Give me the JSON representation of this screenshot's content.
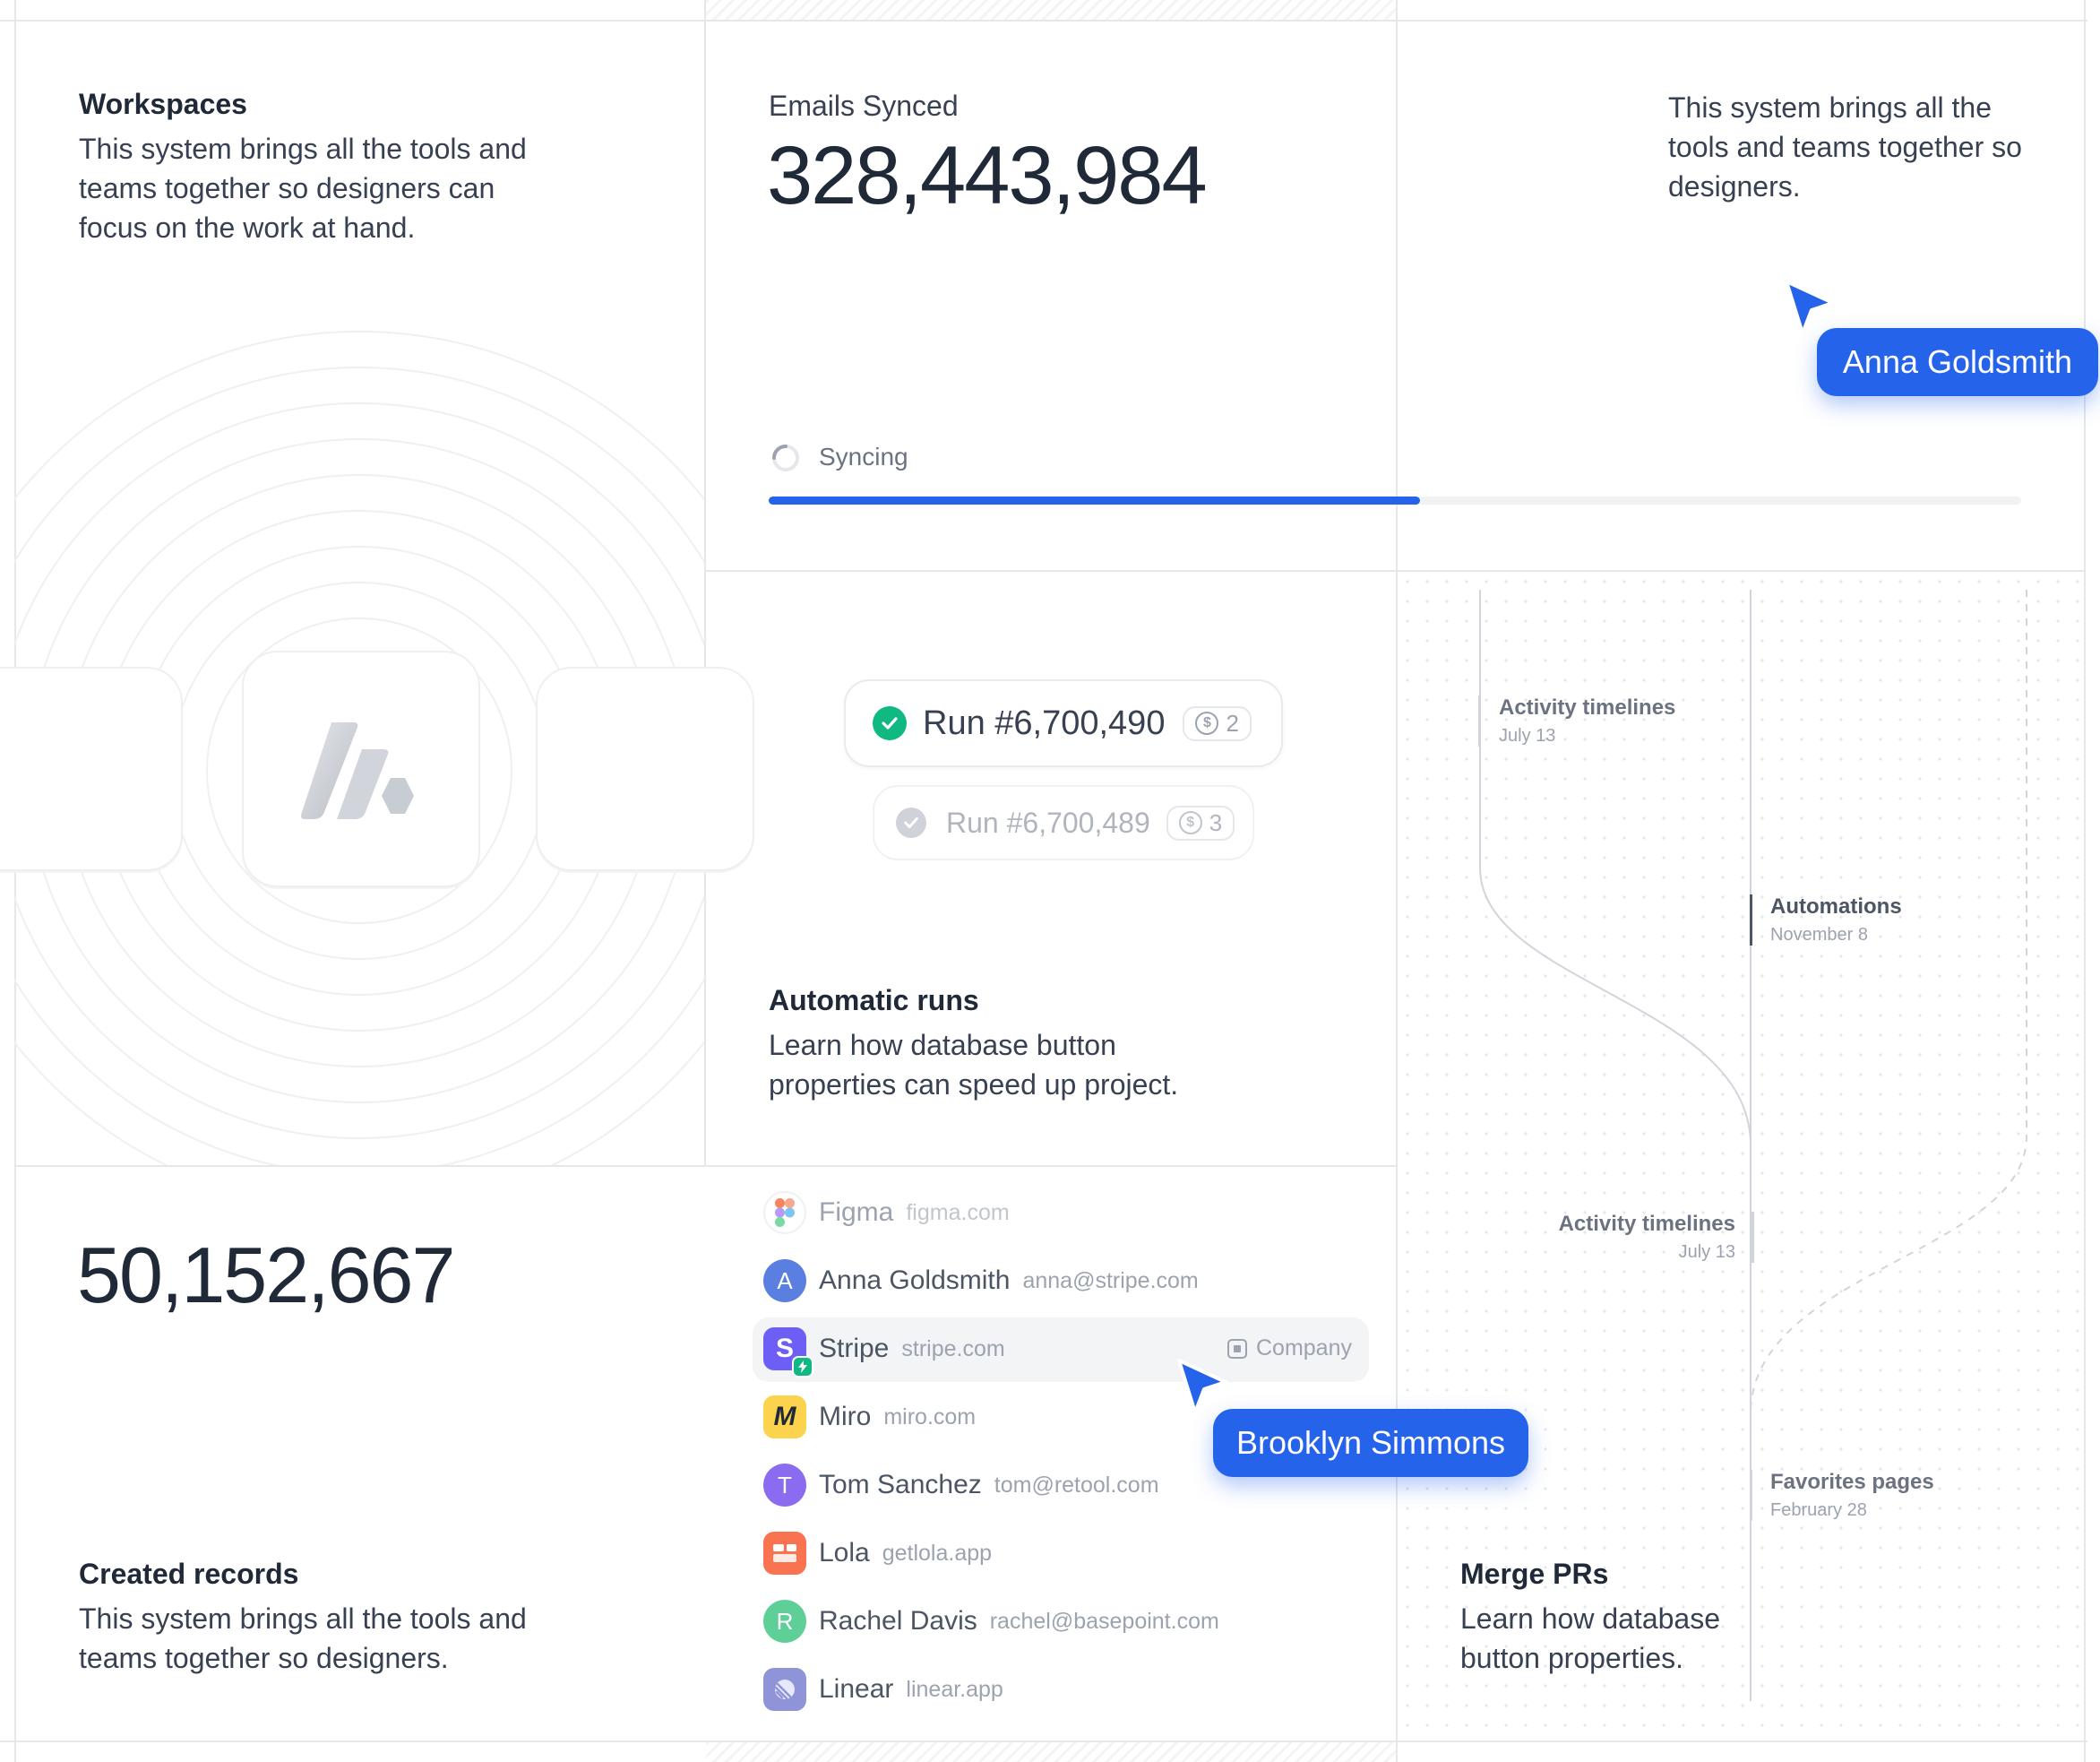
{
  "workspaces": {
    "title": "Workspaces",
    "description": "This system brings all the tools and teams together so designers can focus on the work at hand."
  },
  "emails": {
    "label": "Emails Synced",
    "count": "328,443,984",
    "side_text": "This system brings all the tools and teams together so designers.",
    "status": "Syncing",
    "progress": 0.52
  },
  "cursors": {
    "anna": "Anna Goldsmith",
    "brooklyn": "Brooklyn Simmons"
  },
  "runs": {
    "items": [
      {
        "label": "Run #6,700,490",
        "count": "2"
      },
      {
        "label": "Run #6,700,489",
        "count": "3"
      }
    ],
    "title": "Automatic runs",
    "description": "Learn how database button properties can speed up project."
  },
  "timeline": {
    "events": [
      {
        "title": "Activity timelines",
        "date": "July 13"
      },
      {
        "title": "Automations",
        "date": "November 8"
      },
      {
        "title": "Activity timelines",
        "date": "July 13"
      },
      {
        "title": "Favorites pages",
        "date": "February 28"
      }
    ]
  },
  "merge": {
    "title": "Merge PRs",
    "description": "Learn how database button properties."
  },
  "records": {
    "count": "50,152,667",
    "title": "Created records",
    "description": "This system brings all the tools and teams together so designers."
  },
  "contacts": [
    {
      "name": "Figma",
      "domain": "figma.com",
      "icon": "figma-logo-icon"
    },
    {
      "name": "Anna Goldsmith",
      "domain": "anna@stripe.com",
      "initial": "A",
      "color": "#5b7fe0"
    },
    {
      "name": "Stripe",
      "domain": "stripe.com",
      "tag": "Company",
      "icon": "stripe-logo-icon"
    },
    {
      "name": "Miro",
      "domain": "miro.com",
      "icon": "miro-logo-icon"
    },
    {
      "name": "Tom Sanchez",
      "domain": "tom@retool.com",
      "initial": "T",
      "color": "#8b6cf0"
    },
    {
      "name": "Lola",
      "domain": "getlola.app",
      "icon": "lola-logo-icon"
    },
    {
      "name": "Rachel Davis",
      "domain": "rachel@basepoint.com",
      "initial": "R",
      "color": "#5fcf98"
    },
    {
      "name": "Linear",
      "domain": "linear.app",
      "icon": "linear-logo-icon"
    }
  ],
  "colors": {
    "accent": "#2563eb",
    "success": "#10b981"
  }
}
